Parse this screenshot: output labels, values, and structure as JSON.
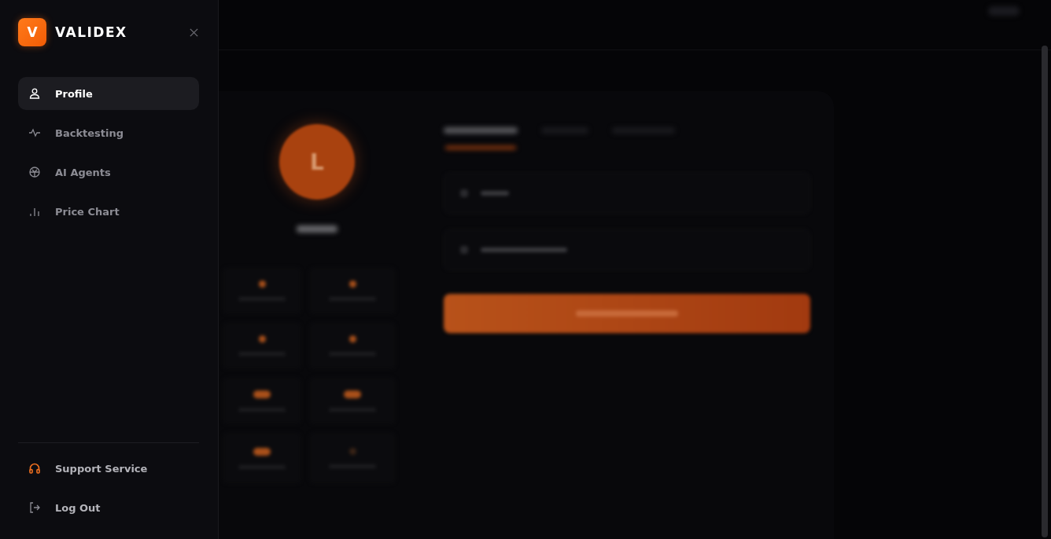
{
  "sidebar": {
    "logo_letter": "V",
    "brand": "VALIDEX",
    "items": [
      {
        "label": "Profile",
        "selected": true
      },
      {
        "label": "Backtesting",
        "selected": false
      },
      {
        "label": "AI Agents",
        "selected": false
      },
      {
        "label": "Price Chart",
        "selected": false
      }
    ],
    "footer": [
      {
        "label": "Support Service"
      },
      {
        "label": "Log Out"
      }
    ]
  },
  "profile": {
    "avatar_letter": "L",
    "tabs": [
      {
        "selected": true
      },
      {
        "selected": false
      },
      {
        "selected": false
      }
    ]
  }
}
